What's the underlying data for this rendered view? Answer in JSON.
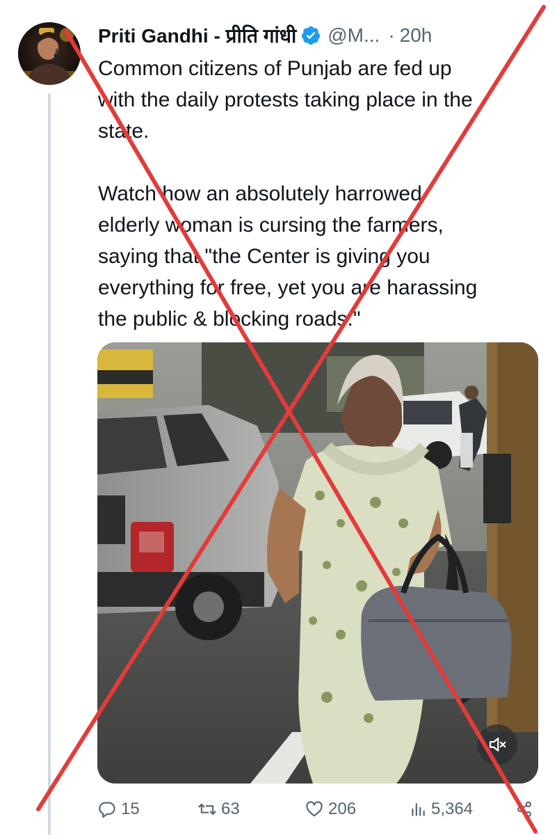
{
  "tweet": {
    "display_name": "Priti Gandhi - प्रीति गांधी",
    "handle": "@M...",
    "separator": "·",
    "time": "20h",
    "paragraphs": [
      "Common citizens of Punjab are fed up\nwith the daily protests taking place in the\nstate.",
      "Watch how an absolutely harrowed\nelderly woman is cursing the farmers,\nsaying that \"the Center is giving you\neverything for free, yet you are harassing\nthe public & blocking roads.\""
    ]
  },
  "actions": {
    "replies": "15",
    "reposts": "63",
    "likes": "206",
    "views": "5,364"
  },
  "icons": {
    "verified": "verified-badge-icon",
    "reply": "reply-icon",
    "repost": "repost-icon",
    "like": "heart-icon",
    "views": "views-chart-icon",
    "share": "share-icon",
    "mute": "speaker-muted-icon"
  },
  "colors": {
    "verified_blue": "#1d9bf0",
    "cross_red": "#e33b3b",
    "secondary_text": "#536471",
    "thread_line": "#cfd9de"
  }
}
